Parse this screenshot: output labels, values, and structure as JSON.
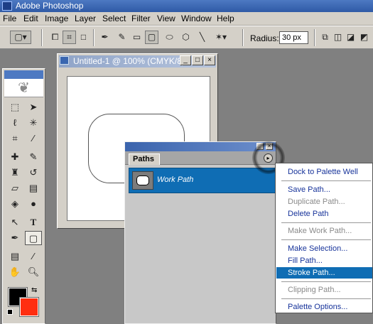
{
  "app": {
    "title": "Adobe Photoshop"
  },
  "menubar": [
    "File",
    "Edit",
    "Image",
    "Layer",
    "Select",
    "Filter",
    "View",
    "Window",
    "Help"
  ],
  "options": {
    "radius_label": "Radius:",
    "radius_value": "30 px"
  },
  "document": {
    "title": "Untitled-1 @ 100% (CMYK/8)",
    "minimize": "_",
    "maximize": "□",
    "close": "×"
  },
  "paths_palette": {
    "tab": "Paths",
    "menu_arrow": "▸",
    "path_name": "Work Path"
  },
  "flyout_menu": {
    "items": [
      {
        "label": "Dock to Palette Well",
        "enabled": true
      },
      {
        "label": "Save Path...",
        "enabled": true
      },
      {
        "label": "Duplicate Path...",
        "enabled": false
      },
      {
        "label": "Delete Path",
        "enabled": true
      },
      {
        "label": "Make Work Path...",
        "enabled": false
      },
      {
        "label": "Make Selection...",
        "enabled": true
      },
      {
        "label": "Fill Path...",
        "enabled": true
      },
      {
        "label": "Stroke Path...",
        "enabled": true,
        "highlighted": true
      },
      {
        "label": "Clipping Path...",
        "enabled": false
      },
      {
        "label": "Palette Options...",
        "enabled": true
      }
    ]
  },
  "colors": {
    "foreground": "#000000",
    "background": "#ff2e10",
    "accent": "#0f6db4"
  }
}
